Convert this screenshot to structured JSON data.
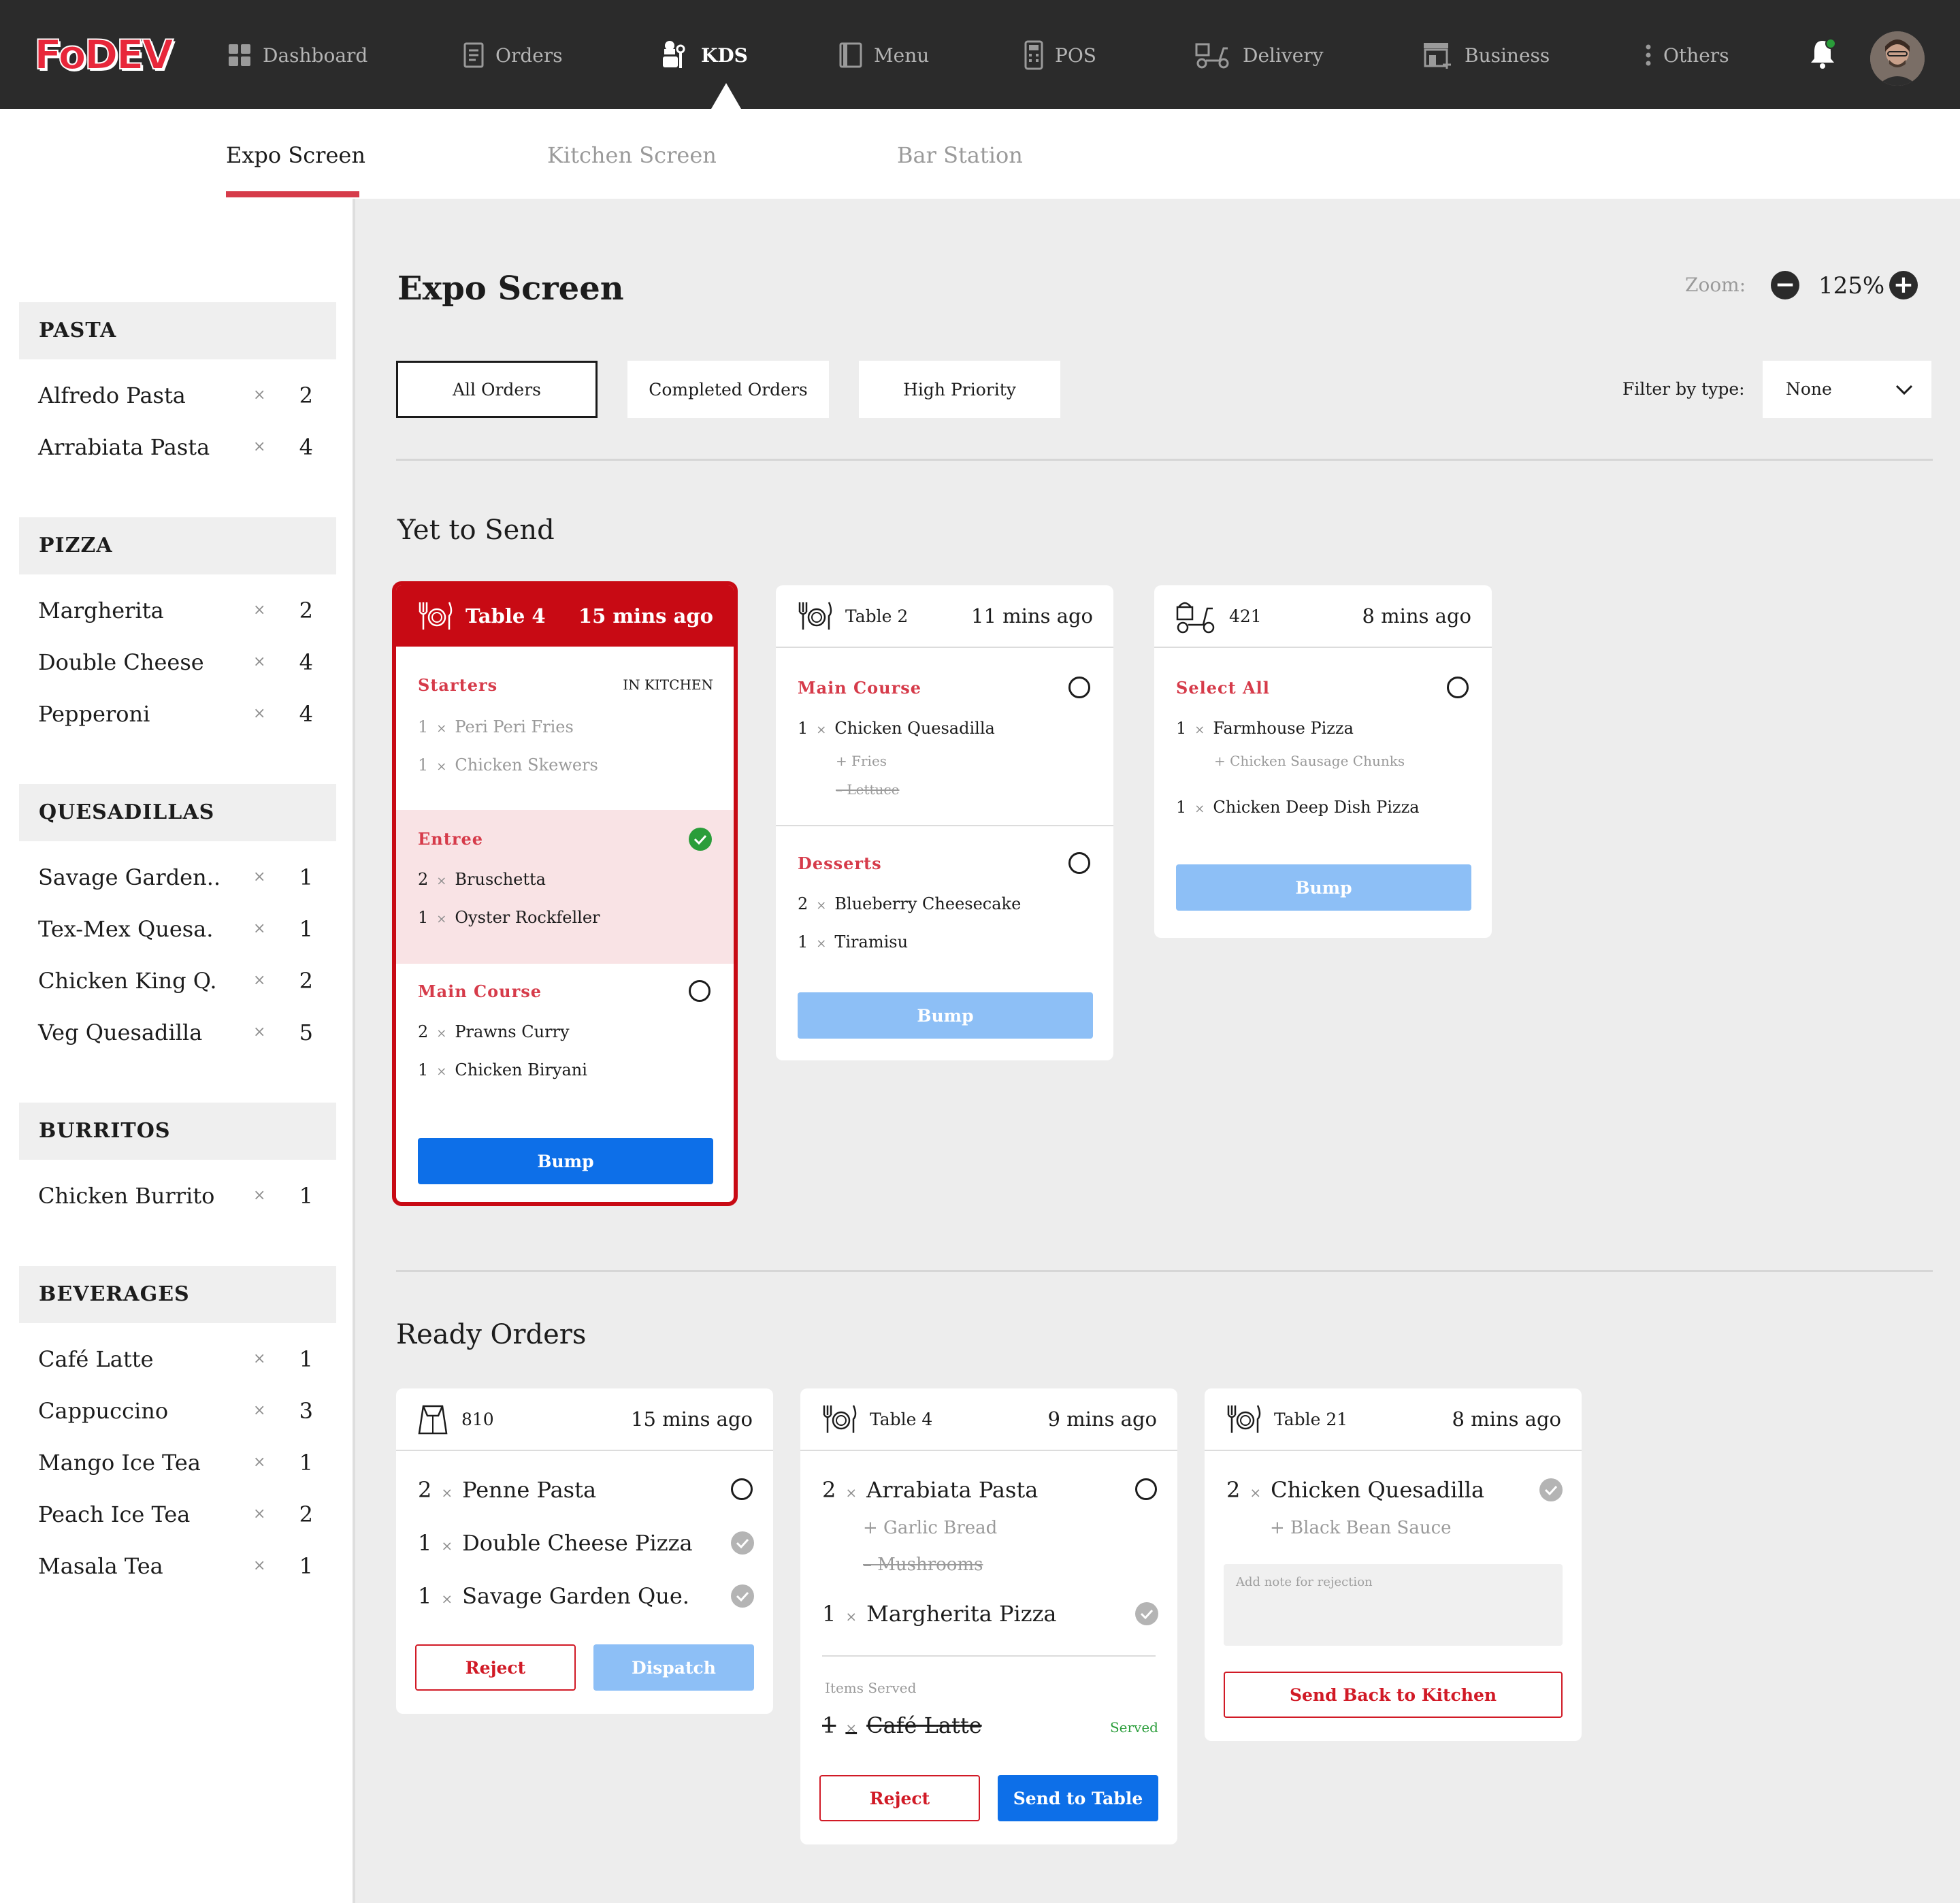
{
  "brand": {
    "logo_text": "FoDEV",
    "accent": "#c80a14"
  },
  "nav": [
    {
      "label": "Dashboard",
      "icon": "dashboard-icon"
    },
    {
      "label": "Orders",
      "icon": "orders-icon"
    },
    {
      "label": "KDS",
      "icon": "chef-icon",
      "active": true
    },
    {
      "label": "Menu",
      "icon": "menu-book-icon"
    },
    {
      "label": "POS",
      "icon": "pos-terminal-icon"
    },
    {
      "label": "Delivery",
      "icon": "delivery-scooter-icon"
    },
    {
      "label": "Business",
      "icon": "business-store-icon"
    },
    {
      "label": "Others",
      "icon": "more-vertical-icon"
    }
  ],
  "subtabs": [
    "Expo Screen",
    "Kitchen Screen",
    "Bar Station"
  ],
  "sidebar": [
    {
      "category": "PASTA",
      "items": [
        {
          "name": "Alfredo Pasta",
          "qty": "2"
        },
        {
          "name": "Arrabiata Pasta",
          "qty": "4"
        }
      ]
    },
    {
      "category": "PIZZA",
      "items": [
        {
          "name": "Margherita",
          "qty": "2"
        },
        {
          "name": "Double Cheese",
          "qty": "4"
        },
        {
          "name": "Pepperoni",
          "qty": "4"
        }
      ]
    },
    {
      "category": "QUESADILLAS",
      "items": [
        {
          "name": "Savage Garden..",
          "qty": "1"
        },
        {
          "name": "Tex-Mex Quesa.",
          "qty": "1"
        },
        {
          "name": "Chicken King Q.",
          "qty": "2"
        },
        {
          "name": "Veg Quesadilla",
          "qty": "5"
        }
      ]
    },
    {
      "category": "BURRITOS",
      "items": [
        {
          "name": "Chicken Burrito",
          "qty": "1"
        }
      ]
    },
    {
      "category": "BEVERAGES",
      "items": [
        {
          "name": "Café Latte",
          "qty": "1"
        },
        {
          "name": "Cappuccino",
          "qty": "3"
        },
        {
          "name": "Mango Ice Tea",
          "qty": "1"
        },
        {
          "name": "Peach Ice Tea",
          "qty": "2"
        },
        {
          "name": "Masala Tea",
          "qty": "1"
        }
      ]
    }
  ],
  "main": {
    "title": "Expo Screen",
    "zoom_label": "Zoom:",
    "zoom_value": "125%",
    "filters": [
      "All Orders",
      "Completed Orders",
      "High Priority"
    ],
    "filter_type_label": "Filter by type:",
    "filter_type_value": "None",
    "yet_to_send": "Yet to Send",
    "ready_orders": "Ready Orders"
  },
  "cards": {
    "t4": {
      "title": "Table 4",
      "time": "15 mins ago",
      "status": "IN KITCHEN",
      "s1": "Starters",
      "s1_items": [
        [
          "1",
          "Peri Peri Fries"
        ],
        [
          "1",
          "Chicken Skewers"
        ]
      ],
      "s2": "Entree",
      "s2_items": [
        [
          "2",
          "Bruschetta"
        ],
        [
          "1",
          "Oyster Rockfeller"
        ]
      ],
      "s3": "Main Course",
      "s3_items": [
        [
          "2",
          "Prawns Curry"
        ],
        [
          "1",
          "Chicken Biryani"
        ]
      ],
      "bump": "Bump"
    },
    "t2": {
      "title": "Table 2",
      "time": "11 mins ago",
      "s1": "Main Course",
      "i1": [
        "1",
        "Chicken Quesadilla"
      ],
      "m1": "+ Fries",
      "m2": "– Lettuce",
      "s2": "Desserts",
      "s2_items": [
        [
          "2",
          "Blueberry Cheesecake"
        ],
        [
          "1",
          "Tiramisu"
        ]
      ],
      "bump": "Bump"
    },
    "d421": {
      "title": "421",
      "time": "8 mins ago",
      "s1": "Select All",
      "i1": [
        "1",
        "Farmhouse Pizza"
      ],
      "m1": "+ Chicken Sausage Chunks",
      "i2": [
        "1",
        "Chicken Deep Dish Pizza"
      ],
      "bump": "Bump"
    },
    "r810": {
      "title": "810",
      "time": "15 mins ago",
      "items": [
        [
          "2",
          "Penne Pasta"
        ],
        [
          "1",
          "Double Cheese Pizza"
        ],
        [
          "1",
          "Savage Garden Que."
        ]
      ],
      "reject": "Reject",
      "dispatch": "Dispatch"
    },
    "rt4": {
      "title": "Table 4",
      "time": "9 mins ago",
      "i1": [
        "2",
        "Arrabiata Pasta"
      ],
      "m1": "+ Garlic Bread",
      "m2": "– Mushrooms",
      "i2": [
        "1",
        "Margherita Pizza"
      ],
      "served_label": "Items Served",
      "served_item": [
        "1",
        "Café Latte"
      ],
      "served_status": "Served",
      "reject": "Reject",
      "send": "Send to Table"
    },
    "rt21": {
      "title": "Table 21",
      "time": "8 mins ago",
      "i1": [
        "2",
        "Chicken Quesadilla"
      ],
      "m1": "+ Black Bean Sauce",
      "note_placeholder": "Add note for rejection",
      "send_back": "Send Back to Kitchen"
    }
  },
  "x_mark": "×"
}
